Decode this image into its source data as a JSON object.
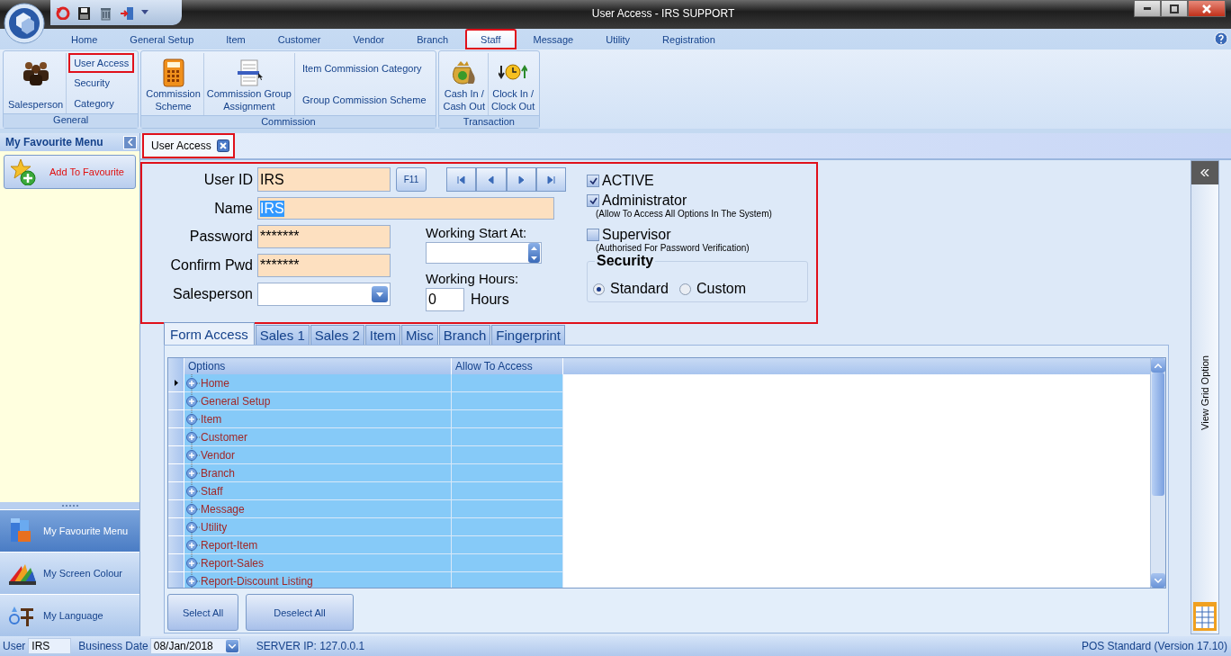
{
  "window": {
    "title": "User Access - IRS SUPPORT"
  },
  "ribbon_tabs": [
    {
      "label": "Home",
      "selected": false,
      "highlighted": false
    },
    {
      "label": "General Setup",
      "selected": false,
      "highlighted": false
    },
    {
      "label": "Item",
      "selected": false,
      "highlighted": false
    },
    {
      "label": "Customer",
      "selected": false,
      "highlighted": false
    },
    {
      "label": "Vendor",
      "selected": false,
      "highlighted": false
    },
    {
      "label": "Branch",
      "selected": false,
      "highlighted": false
    },
    {
      "label": "Staff",
      "selected": true,
      "highlighted": true
    },
    {
      "label": "Message",
      "selected": false,
      "highlighted": false
    },
    {
      "label": "Utility",
      "selected": false,
      "highlighted": false
    },
    {
      "label": "Registration",
      "selected": false,
      "highlighted": false
    }
  ],
  "ribbon_groups": [
    {
      "label": "General",
      "items": [
        {
          "kind": "large",
          "label": "Salesperson",
          "highlighted": false
        },
        {
          "kind": "small",
          "label": "User Access",
          "highlighted": true
        },
        {
          "kind": "small",
          "label": "Security",
          "highlighted": false
        },
        {
          "kind": "small",
          "label": "Category",
          "highlighted": false
        }
      ]
    },
    {
      "label": "Commission",
      "items": [
        {
          "kind": "large",
          "label": "Commission\nScheme",
          "highlighted": false
        },
        {
          "kind": "large",
          "label": "Commission Group\nAssignment",
          "highlighted": false
        },
        {
          "kind": "small",
          "label": "Item Commission Category",
          "highlighted": false
        },
        {
          "kind": "small",
          "label": "Group Commission Scheme",
          "highlighted": false
        }
      ]
    },
    {
      "label": "Transaction",
      "items": [
        {
          "kind": "large",
          "label": "Cash In /\nCash Out",
          "highlighted": false
        },
        {
          "kind": "large",
          "label": "Clock In /\nClock Out",
          "highlighted": false
        }
      ]
    }
  ],
  "sidebar": {
    "title": "My Favourite Menu",
    "add_button": "Add To Favourite",
    "nav": [
      {
        "label": "My Favourite Menu",
        "selected": true
      },
      {
        "label": "My Screen Colour",
        "selected": false
      },
      {
        "label": "My Language",
        "selected": false
      }
    ]
  },
  "document_tabs": [
    {
      "label": "User Access",
      "selected": true,
      "highlighted": true
    }
  ],
  "form": {
    "highlighted": true,
    "user_id": {
      "label": "User ID",
      "value": "IRS"
    },
    "lookup_button": "F11",
    "name": {
      "label": "Name",
      "value": "IRS",
      "text_selected": true
    },
    "password": {
      "label": "Password",
      "value": "*******"
    },
    "confirm_password": {
      "label": "Confirm Pwd",
      "value": "*******"
    },
    "salesperson": {
      "label": "Salesperson"
    },
    "working_start": {
      "label": "Working Start At:"
    },
    "working_hours": {
      "label": "Working Hours:",
      "value": "0",
      "unit": "Hours"
    },
    "flags": [
      {
        "label": "ACTIVE",
        "checked": true
      },
      {
        "label": "Administrator",
        "checked": true,
        "note": "(Allow To Access All Options In The System)"
      },
      {
        "label": "Supervisor",
        "checked": false,
        "note": "(Authorised For Password Verification)"
      }
    ],
    "security": {
      "title": "Security",
      "options": [
        {
          "label": "Standard",
          "selected": true
        },
        {
          "label": "Custom",
          "selected": false
        }
      ]
    }
  },
  "detail_tabs": [
    {
      "label": "Form Access",
      "selected": true
    },
    {
      "label": "Sales 1",
      "selected": false
    },
    {
      "label": "Sales 2",
      "selected": false
    },
    {
      "label": "Item",
      "selected": false
    },
    {
      "label": "Misc",
      "selected": false
    },
    {
      "label": "Branch",
      "selected": false
    },
    {
      "label": "Fingerprint",
      "selected": false
    }
  ],
  "access_grid": {
    "columns": [
      "Options",
      "Allow To Access"
    ],
    "rows": [
      {
        "option": "Home",
        "current": true
      },
      {
        "option": "General Setup",
        "current": false
      },
      {
        "option": "Item",
        "current": false
      },
      {
        "option": "Customer",
        "current": false
      },
      {
        "option": "Vendor",
        "current": false
      },
      {
        "option": "Branch",
        "current": false
      },
      {
        "option": "Staff",
        "current": false
      },
      {
        "option": "Message",
        "current": false
      },
      {
        "option": "Utility",
        "current": false
      },
      {
        "option": "Report-Item",
        "current": false
      },
      {
        "option": "Report-Sales",
        "current": false
      },
      {
        "option": "Report-Discount Listing",
        "current": false
      }
    ]
  },
  "grid_buttons": [
    "Select All",
    "Deselect All"
  ],
  "side_panel": {
    "label": "View Grid Option"
  },
  "status_bar": {
    "user_label": "User",
    "user": "IRS",
    "date_label": "Business Date",
    "date": "08/Jan/2018",
    "server": "SERVER IP: 127.0.0.1",
    "version": "POS Standard (Version 17.10)"
  }
}
